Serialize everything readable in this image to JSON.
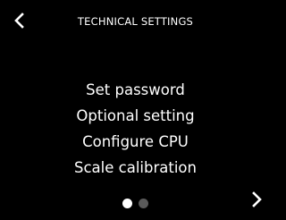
{
  "header": {
    "title": "TECHNICAL SETTINGS",
    "back_icon": "chevron-left-icon"
  },
  "menu": {
    "items": [
      {
        "label": "Set password"
      },
      {
        "label": "Optional setting"
      },
      {
        "label": "Configure CPU"
      },
      {
        "label": "Scale calibration"
      }
    ]
  },
  "pager": {
    "current_page": 1,
    "total_pages": 2,
    "next_icon": "chevron-right-icon"
  },
  "colors": {
    "background": "#000000",
    "text": "#ffffff",
    "dot_active": "#ffffff",
    "dot_inactive": "#5a5a5a"
  }
}
